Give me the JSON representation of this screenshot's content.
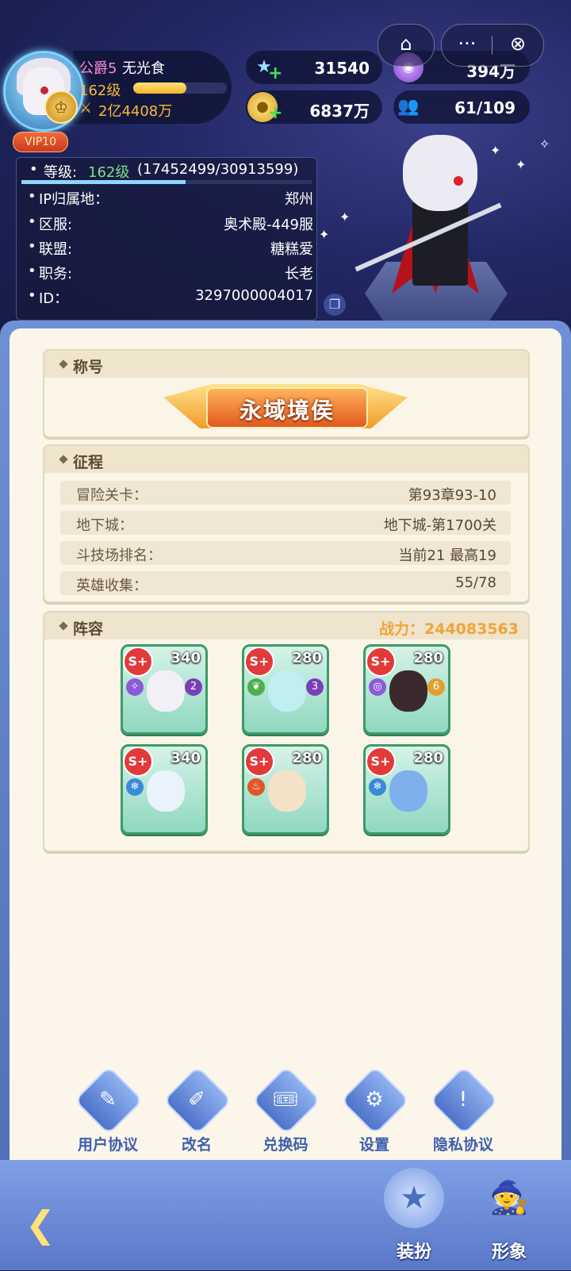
{
  "profile": {
    "rank_title": "公爵5",
    "name": "无光食",
    "level_short": "162级",
    "level_progress": 0.565,
    "power_short": "2亿4408万",
    "vip": "VIP10"
  },
  "currencies": [
    {
      "icon": "crystal-star-icon",
      "value": "31540"
    },
    {
      "icon": "purple-orb-icon",
      "value": "394万"
    },
    {
      "icon": "gold-coin-icon",
      "value": "6837万"
    },
    {
      "icon": "people-icon",
      "value": "61/109"
    }
  ],
  "capsule": {
    "home_icon": "⌂",
    "more_icon": "···",
    "close_icon": "⊗"
  },
  "info": {
    "level_label": "等级:",
    "level_value": "162级",
    "exp": "(17452499/30913599)",
    "exp_progress": 0.565,
    "rows": [
      {
        "label": "IP归属地：",
        "value": "郑州"
      },
      {
        "label": "区服:",
        "value": "奥术殿-449服"
      },
      {
        "label": "联盟:",
        "value": "糖糕爱"
      },
      {
        "label": "职务:",
        "value": "长老"
      },
      {
        "label": "ID：",
        "value": "3297000004017"
      }
    ]
  },
  "honor": {
    "title": "称号",
    "badge": "永域境侯"
  },
  "expedition": {
    "title": "征程",
    "rows": [
      {
        "label": "冒险关卡：",
        "value": "第93章93-10"
      },
      {
        "label": "地下城：",
        "value": "地下城-第1700关"
      },
      {
        "label": "斗技场排名：",
        "value": "当前21  最高19"
      },
      {
        "label": "英雄收集：",
        "value": "55/78"
      }
    ]
  },
  "lineup": {
    "title": "阵容",
    "power": "战力：244083563",
    "heroes": [
      {
        "level": "340",
        "grade": "S+",
        "badge": "2"
      },
      {
        "level": "280",
        "grade": "S+",
        "badge": "3"
      },
      {
        "level": "280",
        "grade": "S+",
        "badge": "6"
      },
      {
        "level": "340",
        "grade": "S+",
        "badge": ""
      },
      {
        "level": "280",
        "grade": "S+",
        "badge": ""
      },
      {
        "level": "280",
        "grade": "S+",
        "badge": ""
      }
    ]
  },
  "bottom_buttons": [
    {
      "icon": "user-agreement-icon",
      "label": "用户协议"
    },
    {
      "icon": "rename-icon",
      "label": "改名"
    },
    {
      "icon": "redeem-code-icon",
      "label": "兑换码"
    },
    {
      "icon": "settings-icon",
      "label": "设置"
    },
    {
      "icon": "privacy-icon",
      "label": "隐私协议"
    }
  ],
  "footer_tabs": [
    {
      "icon": "outfit-icon",
      "label": "装扮"
    },
    {
      "icon": "appearance-icon",
      "label": "形象"
    }
  ],
  "colors": {
    "accent_gold": "#f7b93a",
    "power_orange": "#f2a33a",
    "level_green": "#7ee08a"
  }
}
